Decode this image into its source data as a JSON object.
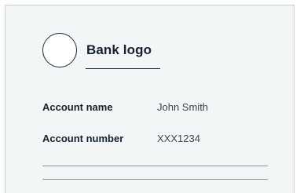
{
  "card": {
    "logo": {
      "icon": "bank-logo-placeholder-circle",
      "label": "Bank logo"
    },
    "fields": [
      {
        "label": "Account name",
        "value": "John Smith"
      },
      {
        "label": "Account number",
        "value": "XXX1234"
      }
    ]
  },
  "colors": {
    "background": "#f2f6f7",
    "border": "#c7d0d3",
    "text_primary": "#14212e",
    "text_secondary": "#3a4550",
    "rule": "#8a9499"
  }
}
